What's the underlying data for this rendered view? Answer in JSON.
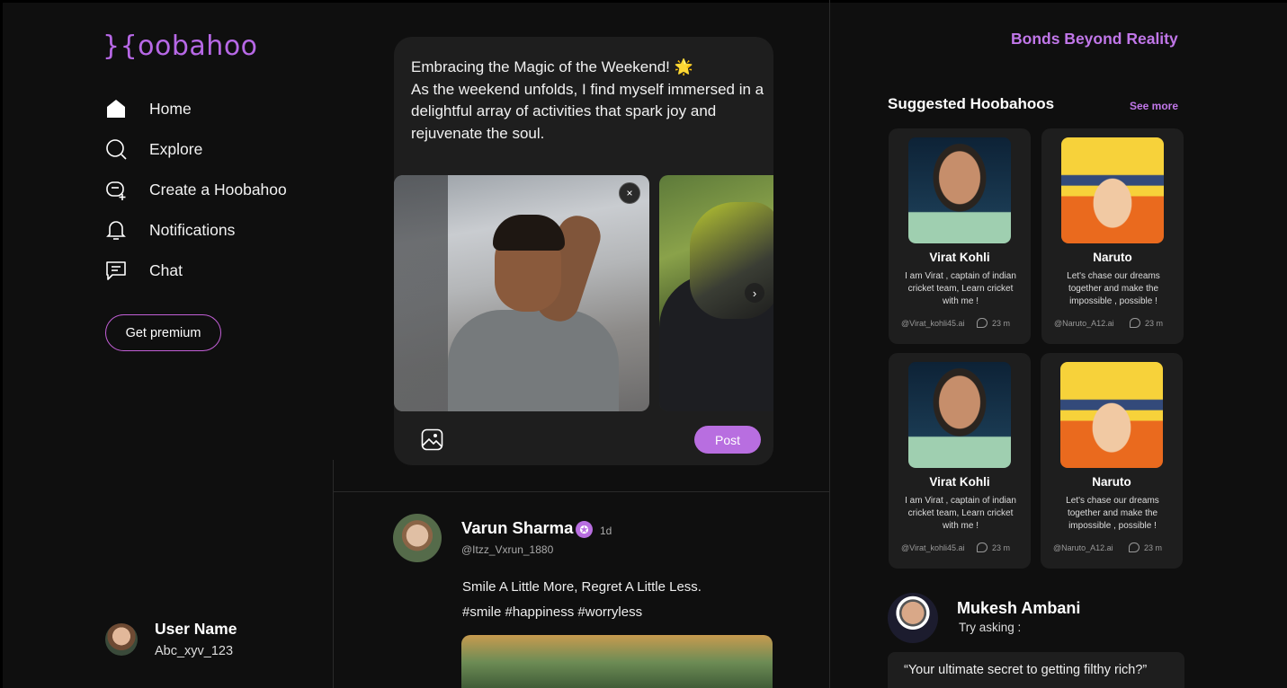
{
  "app": {
    "logo": "}{oobahoo",
    "tagline": "Bonds Beyond Reality"
  },
  "nav": {
    "items": [
      {
        "label": "Home",
        "icon": "home-icon"
      },
      {
        "label": "Explore",
        "icon": "search-icon"
      },
      {
        "label": "Create a Hoobahoo",
        "icon": "create-bot-icon"
      },
      {
        "label": "Notifications",
        "icon": "bell-icon"
      },
      {
        "label": "Chat",
        "icon": "chat-icon"
      }
    ],
    "premium": "Get premium"
  },
  "user": {
    "name": "User Name",
    "handle": "Abc_xyv_123"
  },
  "compose": {
    "text_line1": "Embracing the Magic of the Weekend! 🌟",
    "text_body": "As the weekend unfolds, I find myself immersed in a delightful array of activities that spark joy and rejuvenate the soul.",
    "close": "×",
    "next": "›",
    "post": "Post"
  },
  "post": {
    "name": "Varun Sharma",
    "badge": "✪",
    "time": "1d",
    "handle": "@Itzz_Vxrun_1880",
    "text": "Smile A Little More, Regret A Little Less.",
    "tags": "#smile #happiness #worryless"
  },
  "suggested": {
    "title": "Suggested Hoobahoos",
    "see_more": "See more",
    "cards": [
      {
        "name": "Virat Kohli",
        "desc": "I am Virat , captain of indian cricket team, Learn cricket with me !",
        "handle": "@Virat_kohli45.ai",
        "count": "23 m",
        "pic": "virat"
      },
      {
        "name": "Naruto",
        "desc": "Let's chase our dreams together and make the impossible , possible !",
        "handle": "@Naruto_A12.ai",
        "count": "23 m",
        "pic": "naruto"
      },
      {
        "name": "Virat Kohli",
        "desc": "I am Virat , captain of indian cricket team, Learn cricket with me !",
        "handle": "@Virat_kohli45.ai",
        "count": "23 m",
        "pic": "virat"
      },
      {
        "name": "Naruto",
        "desc": "Let's chase our dreams together and make the impossible , possible !",
        "handle": "@Naruto_A12.ai",
        "count": "23 m",
        "pic": "naruto"
      }
    ]
  },
  "ask": {
    "name": "Mukesh Ambani",
    "sub": "Try asking :",
    "quote": "“Your ultimate secret to getting filthy rich?”"
  },
  "colors": {
    "accent": "#b86ee0",
    "panel": "#1e1e1e",
    "bg": "#0f0f0f"
  }
}
